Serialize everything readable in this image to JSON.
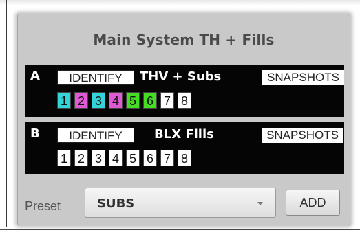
{
  "panel": {
    "title": "Main System TH + Fills"
  },
  "zones": [
    {
      "letter": "A",
      "identify_label": "IDENTIFY",
      "name": "THV + Subs",
      "snapshots_label": "SNAPSHOTS",
      "snapshots": [
        {
          "label": "1",
          "color": "#33d4d8"
        },
        {
          "label": "2",
          "color": "#e05ad6"
        },
        {
          "label": "3",
          "color": "#33d4d8"
        },
        {
          "label": "4",
          "color": "#e05ad6"
        },
        {
          "label": "5",
          "color": "#44dd22"
        },
        {
          "label": "6",
          "color": "#44dd22"
        },
        {
          "label": "7",
          "color": "#ffffff"
        },
        {
          "label": "8",
          "color": "#ffffff"
        }
      ]
    },
    {
      "letter": "B",
      "identify_label": "IDENTIFY",
      "name": "BLX Fills",
      "snapshots_label": "SNAPSHOTS",
      "snapshots": [
        {
          "label": "1",
          "color": "#ffffff"
        },
        {
          "label": "2",
          "color": "#ffffff"
        },
        {
          "label": "3",
          "color": "#ffffff"
        },
        {
          "label": "4",
          "color": "#ffffff"
        },
        {
          "label": "5",
          "color": "#ffffff"
        },
        {
          "label": "6",
          "color": "#ffffff"
        },
        {
          "label": "7",
          "color": "#ffffff"
        },
        {
          "label": "8",
          "color": "#ffffff"
        }
      ]
    }
  ],
  "footer": {
    "preset_label": "Preset",
    "preset_value": "SUBS",
    "add_label": "ADD"
  }
}
